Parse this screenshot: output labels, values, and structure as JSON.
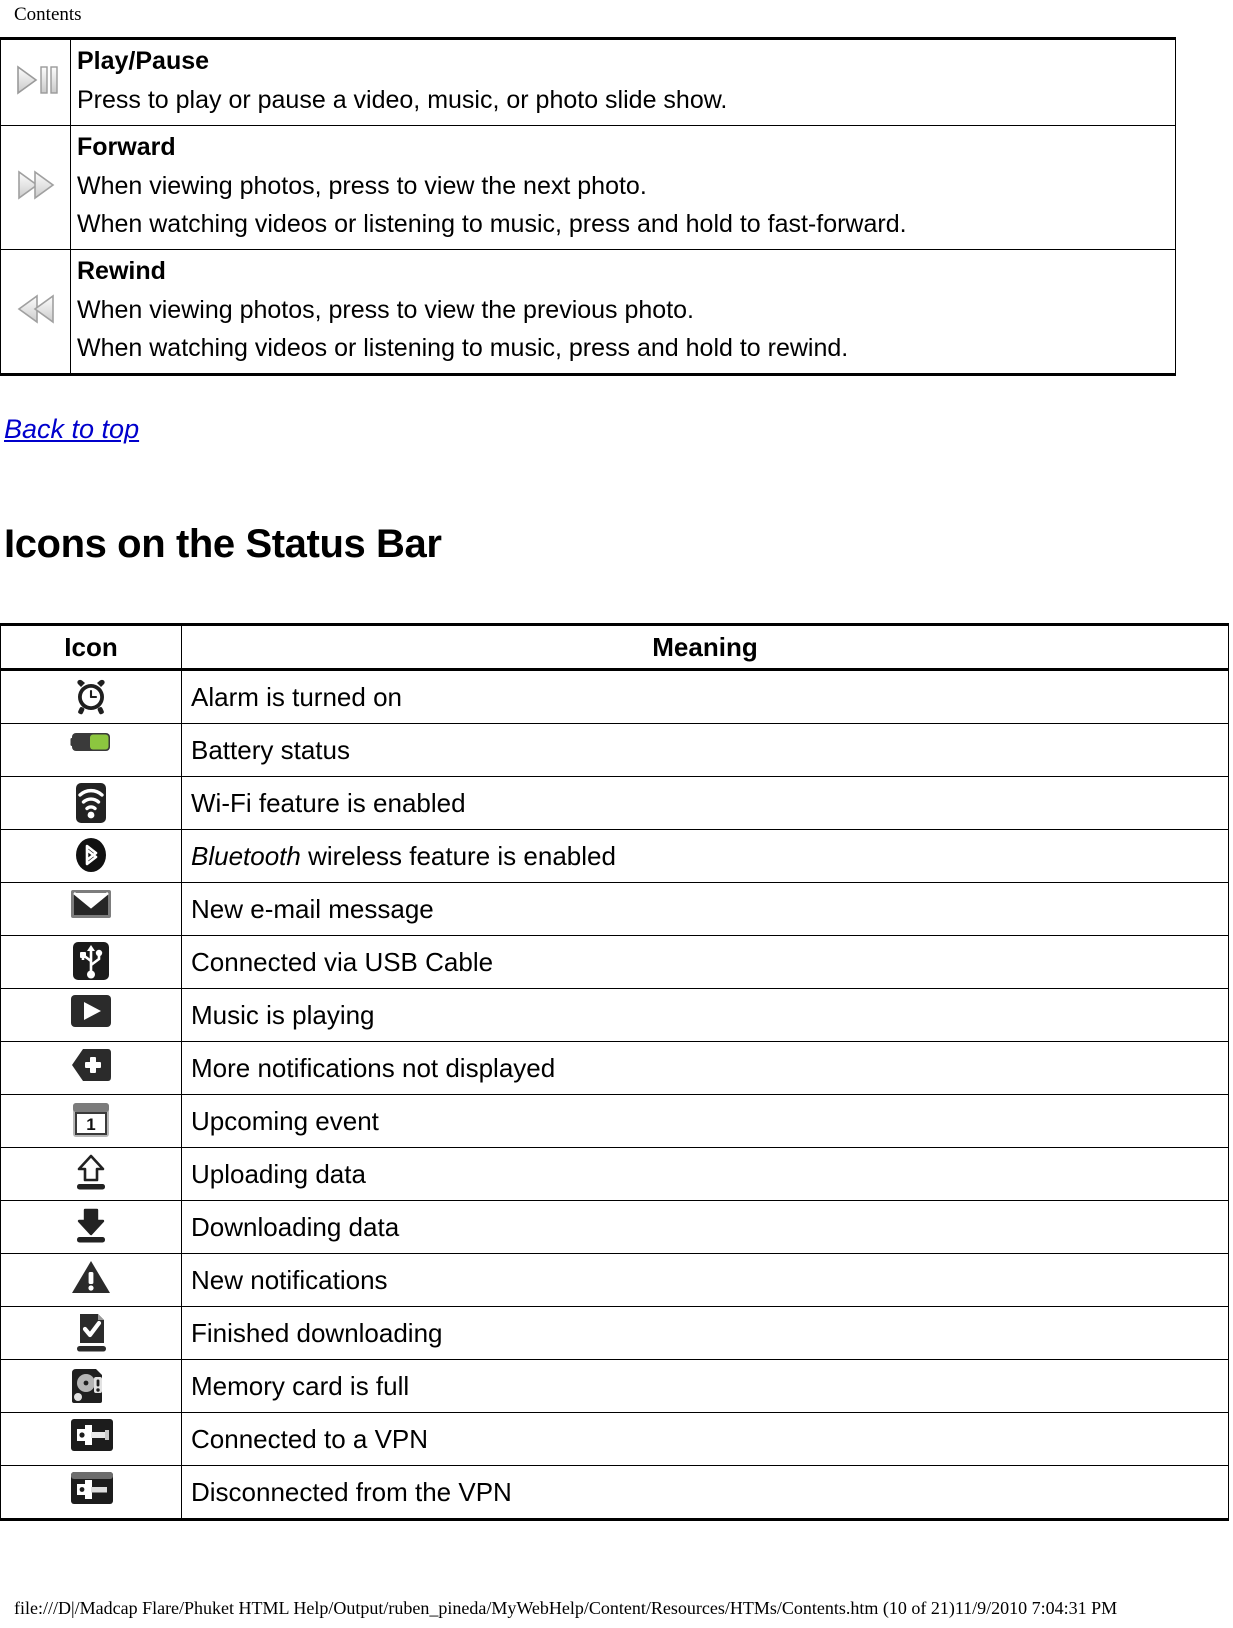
{
  "breadcrumb": "Contents",
  "media_keys_table": {
    "rows": [
      {
        "icon": "play-pause-icon",
        "title": "Play/Pause",
        "lines": [
          "Press to play or pause a video, music, or photo slide show."
        ]
      },
      {
        "icon": "fast-forward-icon",
        "title": "Forward",
        "lines": [
          "When viewing photos, press to view the next photo.",
          "When watching videos or listening to music, press and hold to fast-forward."
        ]
      },
      {
        "icon": "rewind-icon",
        "title": "Rewind",
        "lines": [
          "When viewing photos, press to view the previous photo.",
          "When watching videos or listening to music, press and hold to rewind."
        ]
      }
    ]
  },
  "back_to_top": "Back to top",
  "section_heading": "Icons on the Status Bar",
  "status_table": {
    "headers": {
      "icon": "Icon",
      "meaning": "Meaning"
    },
    "rows": [
      {
        "icon": "alarm-clock-icon",
        "meaning": "Alarm is turned on"
      },
      {
        "icon": "battery-status-icon",
        "meaning": "Battery status"
      },
      {
        "icon": "wifi-icon",
        "meaning": "Wi-Fi feature is enabled"
      },
      {
        "icon": "bluetooth-icon",
        "meaning_em": "Bluetooth",
        "meaning": " wireless feature is enabled"
      },
      {
        "icon": "new-email-icon",
        "meaning": "New e-mail message"
      },
      {
        "icon": "usb-icon",
        "meaning": "Connected via USB Cable"
      },
      {
        "icon": "music-playing-icon",
        "meaning": "Music is playing"
      },
      {
        "icon": "more-notifications-icon",
        "meaning": "More notifications not displayed"
      },
      {
        "icon": "calendar-event-icon",
        "meaning": "Upcoming event"
      },
      {
        "icon": "upload-icon",
        "meaning": "Uploading data"
      },
      {
        "icon": "download-icon",
        "meaning": "Downloading data"
      },
      {
        "icon": "warning-icon",
        "meaning": "New notifications"
      },
      {
        "icon": "download-complete-icon",
        "meaning": "Finished downloading"
      },
      {
        "icon": "memory-card-full-icon",
        "meaning": "Memory card is full"
      },
      {
        "icon": "vpn-connected-icon",
        "meaning": "Connected to a VPN"
      },
      {
        "icon": "vpn-disconnected-icon",
        "meaning": "Disconnected from the VPN"
      }
    ]
  },
  "colors": {
    "link": "#0000cc",
    "battery_green": "#8cc63f",
    "icon_dark": "#1f1f1f",
    "icon_grey": "#8a8a8a"
  },
  "footer": "file:///D|/Madcap Flare/Phuket HTML Help/Output/ruben_pineda/MyWebHelp/Content/Resources/HTMs/Contents.htm (10 of 21)11/9/2010 7:04:31 PM"
}
